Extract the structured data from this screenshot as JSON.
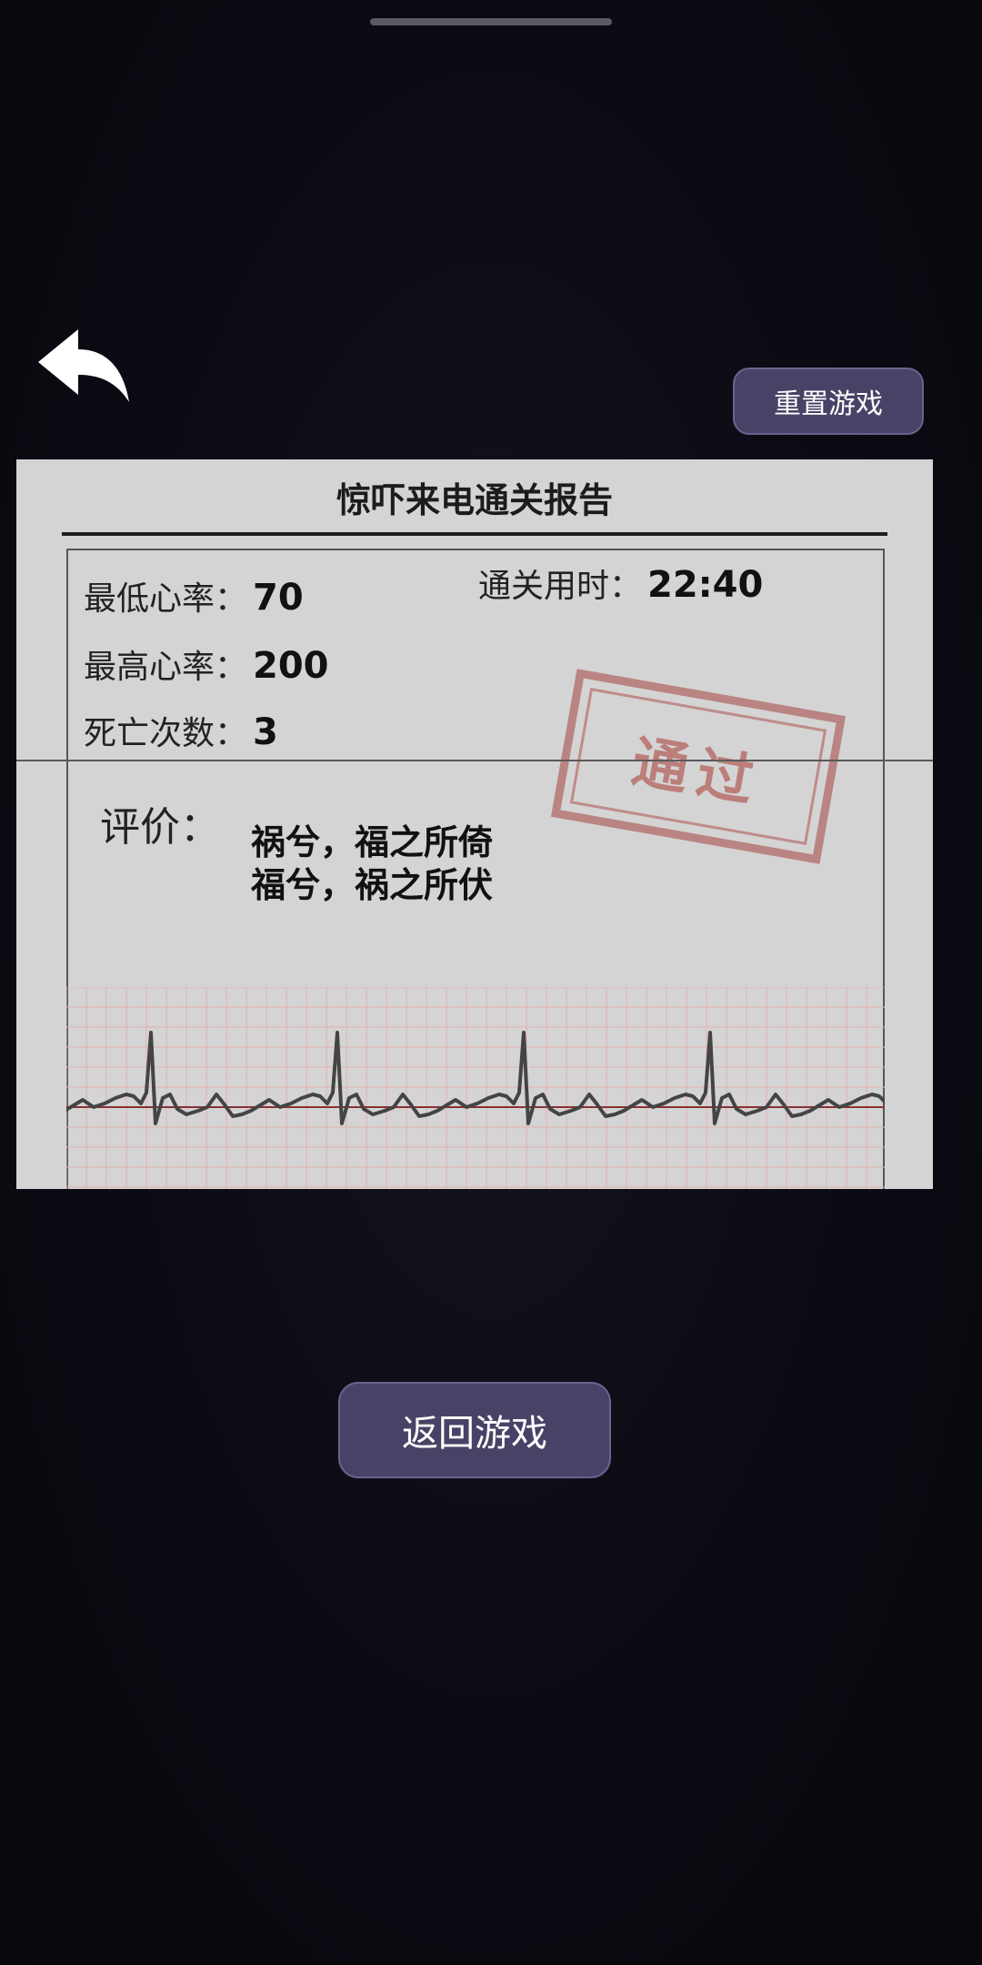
{
  "header": {
    "reset_label": "重置游戏"
  },
  "report": {
    "title": "惊吓来电通关报告",
    "stats": {
      "min_heart_rate_label": "最低心率：",
      "min_heart_rate_value": "70",
      "max_heart_rate_label": "最高心率：",
      "max_heart_rate_value": "200",
      "deaths_label": "死亡次数：",
      "deaths_value": "3",
      "clear_time_label": "通关用时：",
      "clear_time_value": "22:40"
    },
    "evaluation": {
      "label": "评价：",
      "line1": "祸兮，福之所倚",
      "line2": "福兮，祸之所伏"
    },
    "stamp_text": "通过",
    "stamp_color": "#b5625c"
  },
  "footer": {
    "return_label": "返回游戏"
  },
  "icons": {
    "back": "back-arrow-icon"
  },
  "colors": {
    "button_bg": "#4a4266",
    "button_border": "#6c6290",
    "paper": "#d4d4d4",
    "grid": "#e0a0a0",
    "trace": "#444444"
  }
}
